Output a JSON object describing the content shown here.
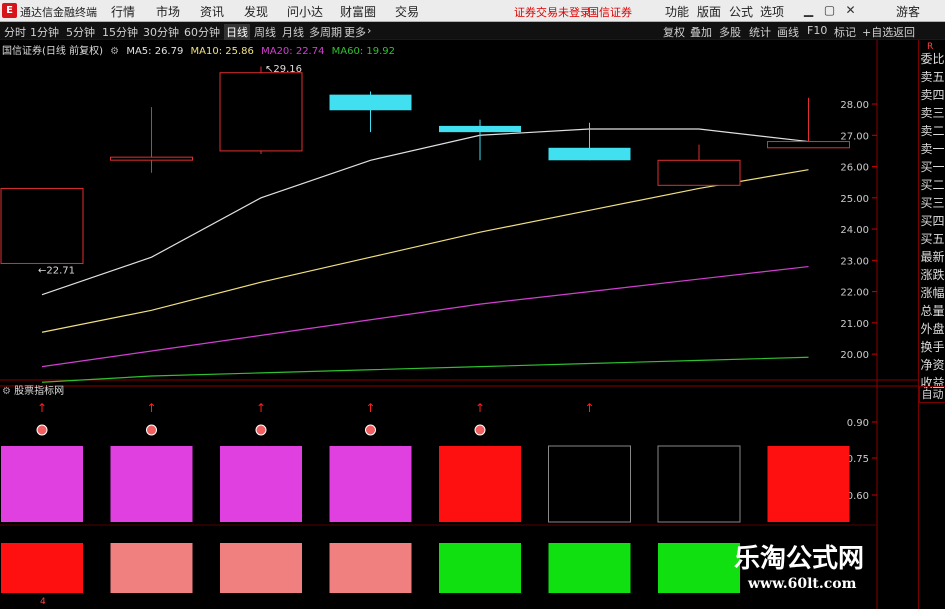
{
  "app": {
    "logo_glyph": "E",
    "title": "通达信金融终端",
    "menu": [
      "行情",
      "市场",
      "资讯",
      "发现",
      "问小达",
      "财富圈",
      "交易"
    ],
    "login_notice": "证券交易未登录",
    "broker": "国信证券",
    "right_menu": [
      "功能",
      "版面",
      "公式",
      "选项"
    ],
    "guest": "游客",
    "window_buttons": [
      "minimize-icon",
      "restore-icon",
      "close-icon"
    ]
  },
  "toolbar": {
    "periods": [
      "分时",
      "1分钟",
      "5分钟",
      "15分钟",
      "30分钟",
      "60分钟",
      "日线",
      "周线",
      "月线",
      "多周期",
      "更多"
    ],
    "active_period": "日线",
    "more_arrow": "›",
    "right_tools": [
      "复权",
      "叠加",
      "多股",
      "统计",
      "画线",
      "F10",
      "标记",
      "+自选",
      "返回"
    ]
  },
  "chart_header": {
    "stock": "国信证券(日线 前复权)",
    "ma5": "MA5: 26.79",
    "ma10": "MA10: 25.86",
    "ma20": "MA20: 22.74",
    "ma60": "MA60: 19.92",
    "colors": {
      "ma5": "#e0e0e0",
      "ma10": "#f0e080",
      "ma20": "#d040d0",
      "ma60": "#30c030"
    }
  },
  "indicator": {
    "title": "股票指标网",
    "yticks": [
      "0.90",
      "0.75",
      "0.60"
    ],
    "top_row_colors": [
      "#e040e0",
      "#e040e0",
      "#e040e0",
      "#e040e0",
      "#ff1010",
      "none",
      "none",
      "#ff1010"
    ],
    "bottom_row_colors": [
      "#ff1010",
      "#f08080",
      "#f08080",
      "#f08080",
      "#10e010",
      "#10e010",
      "#10e010",
      "#ffffff"
    ],
    "arrows": [
      true,
      true,
      true,
      true,
      true,
      true,
      false,
      false
    ],
    "balls": [
      true,
      true,
      true,
      true,
      true,
      false,
      false,
      false
    ],
    "bottom_mark": "4"
  },
  "right_panel": [
    "委比",
    "卖五",
    "卖四",
    "卖三",
    "卖二",
    "卖一",
    "买一",
    "买二",
    "买三",
    "买四",
    "买五",
    "最新",
    "涨跌",
    "涨幅",
    "总量",
    "外盘",
    "换手",
    "净资",
    "收益"
  ],
  "right_panel_label_top": "R",
  "right_panel_auto": "自动",
  "watermark": {
    "name": "乐淘公式网",
    "url": "www.60lt.com"
  },
  "chart_data": {
    "type": "candlestick",
    "yticks": [
      28.0,
      27.0,
      26.0,
      25.0,
      24.0,
      23.0,
      22.0,
      21.0,
      20.0
    ],
    "ylim": [
      19.3,
      29.6
    ],
    "annotations": {
      "high_label": "29.16",
      "low_label": "22.71"
    },
    "candles": [
      {
        "open": 25.3,
        "close": 22.9,
        "high": 25.3,
        "low": 22.9,
        "color": "red"
      },
      {
        "open": 26.3,
        "close": 26.3,
        "high": 27.9,
        "low": 25.8,
        "color": "red"
      },
      {
        "open": 29.0,
        "close": 26.5,
        "high": 29.2,
        "low": 26.4,
        "color": "red"
      },
      {
        "open": 28.3,
        "close": 27.8,
        "high": 28.4,
        "low": 27.1,
        "color": "cyan"
      },
      {
        "open": 27.3,
        "close": 27.1,
        "high": 27.5,
        "low": 26.2,
        "color": "cyan"
      },
      {
        "open": 26.6,
        "close": 26.2,
        "high": 27.4,
        "low": 26.2,
        "color": "cyan"
      },
      {
        "open": 25.4,
        "close": 26.2,
        "high": 26.7,
        "low": 25.4,
        "color": "red"
      },
      {
        "open": 26.6,
        "close": 26.8,
        "high": 28.2,
        "low": 26.6,
        "color": "red"
      }
    ],
    "series": [
      {
        "name": "MA5",
        "color": "#e0e0e0",
        "values": [
          21.9,
          23.1,
          25.0,
          26.2,
          27.0,
          27.2,
          27.2,
          26.8
        ]
      },
      {
        "name": "MA10",
        "color": "#f0e080",
        "values": [
          20.7,
          21.4,
          22.3,
          23.1,
          23.9,
          24.6,
          25.3,
          25.9
        ]
      },
      {
        "name": "MA20",
        "color": "#d040d0",
        "values": [
          19.6,
          20.1,
          20.6,
          21.1,
          21.6,
          22.0,
          22.4,
          22.8
        ]
      },
      {
        "name": "MA60",
        "color": "#30c030",
        "values": [
          19.1,
          19.3,
          19.4,
          19.5,
          19.6,
          19.7,
          19.8,
          19.9
        ]
      }
    ]
  }
}
